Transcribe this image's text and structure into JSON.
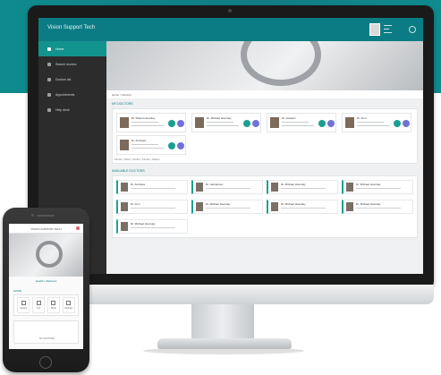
{
  "app": {
    "title": "Vision Support Tech"
  },
  "sidebar": {
    "items": [
      {
        "label": "Home"
      },
      {
        "label": "Search doctors"
      },
      {
        "label": "Doctors list"
      },
      {
        "label": "Appointments"
      },
      {
        "label": "Help desk"
      }
    ]
  },
  "breadcrumb": "Home > Doctors",
  "sections": {
    "my_doctors": "MY DOCTORS",
    "available": "AVAILABLE DOCTORS"
  },
  "my_doctors": [
    {
      "name": "Dr. Robert Hoursley"
    },
    {
      "name": "Dr. Michael Hoursley"
    },
    {
      "name": "Dr. Hussain"
    },
    {
      "name": "Dr. Finn"
    },
    {
      "name": "Dr. Andrews"
    }
  ],
  "filters": "Finder | Filter | Finder | Finder | Status",
  "available_doctors": [
    {
      "name": "Dr. Andrews"
    },
    {
      "name": "Dr. Henderson"
    },
    {
      "name": "Dr. Michael Hoursley"
    },
    {
      "name": "Dr. Michael Hoursley"
    },
    {
      "name": "Dr. Finn"
    },
    {
      "name": "Dr. Michael Hoursley"
    },
    {
      "name": "Dr. Michael Hoursley"
    },
    {
      "name": "Dr. Michael Hoursley"
    },
    {
      "name": "Dr. Michael Hoursley"
    }
  ],
  "mobile": {
    "title": "VISION SUPPORT TECH",
    "welcome": "Health • Wellness",
    "section": "HOME",
    "tiles": [
      {
        "label": "Search"
      },
      {
        "label": "List"
      },
      {
        "label": "Book"
      },
      {
        "label": "Settings"
      }
    ],
    "card_caption": "MY DOCTORS"
  },
  "colors": {
    "accent": "#0c7c84",
    "band": "#0f8b8d",
    "sidebar": "#2c2c2c"
  }
}
